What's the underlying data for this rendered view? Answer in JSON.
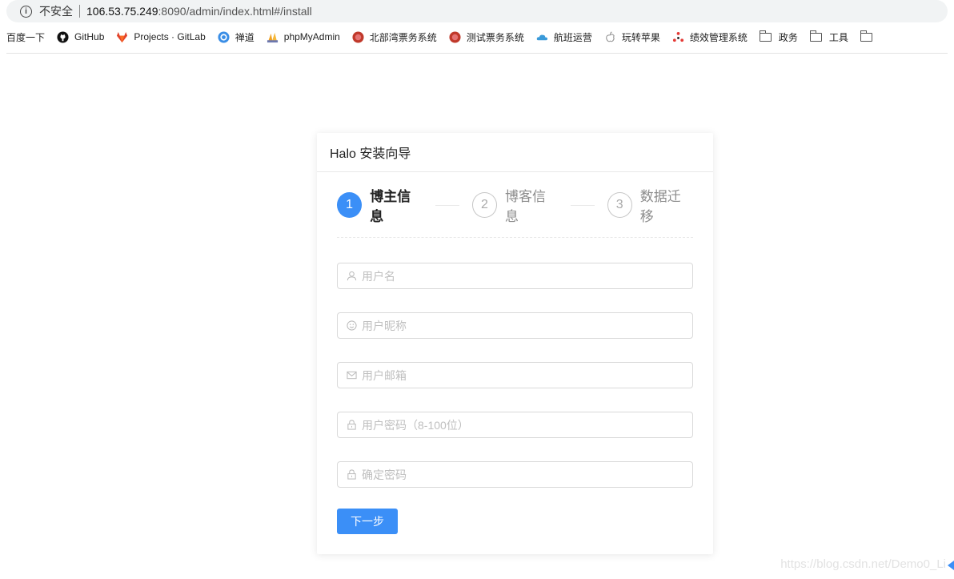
{
  "address_bar": {
    "security_text": "不安全",
    "host": "106.53.75.249",
    "path": ":8090/admin/index.html#/install"
  },
  "bookmarks": [
    {
      "label": "百度一下",
      "icon": "",
      "color": ""
    },
    {
      "label": "GitHub",
      "icon": "github-icon",
      "color": "#111111"
    },
    {
      "label": "Projects · GitLab",
      "icon": "gitlab-icon",
      "color": "#e2432a"
    },
    {
      "label": "禅道",
      "icon": "zentao-icon",
      "color": "#3a8ee6"
    },
    {
      "label": "phpMyAdmin",
      "icon": "phpmyadmin-icon",
      "color": "#f0a020"
    },
    {
      "label": "北部湾票务系统",
      "icon": "ticket-icon",
      "color": "#c0392b"
    },
    {
      "label": "测试票务系统",
      "icon": "ticket-icon",
      "color": "#c0392b"
    },
    {
      "label": "航班运营",
      "icon": "cloud-icon",
      "color": "#3a9ad9"
    },
    {
      "label": "玩转苹果",
      "icon": "apple-icon",
      "color": "#999999"
    },
    {
      "label": "绩效管理系统",
      "icon": "dots-icon",
      "color": "#e53935"
    },
    {
      "label": "政务",
      "icon": "folder-icon",
      "color": ""
    },
    {
      "label": "工具",
      "icon": "folder-icon",
      "color": ""
    },
    {
      "label": "",
      "icon": "folder-icon",
      "color": ""
    }
  ],
  "card": {
    "title": "Halo 安装向导",
    "steps": [
      {
        "number": "1",
        "label": "博主信息",
        "active": true
      },
      {
        "number": "2",
        "label": "博客信息",
        "active": false
      },
      {
        "number": "3",
        "label": "数据迁移",
        "active": false
      }
    ],
    "fields": [
      {
        "placeholder": "用户名",
        "value": "",
        "icon": "user-icon"
      },
      {
        "placeholder": "用户昵称",
        "value": "",
        "icon": "smile-icon"
      },
      {
        "placeholder": "用户邮箱",
        "value": "",
        "icon": "mail-icon"
      },
      {
        "placeholder": "用户密码（8-100位）",
        "value": "",
        "icon": "lock-icon"
      },
      {
        "placeholder": "确定密码",
        "value": "",
        "icon": "lock-icon"
      }
    ],
    "next_button": "下一步"
  },
  "watermark": "https://blog.csdn.net/Demo0_Li",
  "colors": {
    "primary": "#3b8ff7",
    "border": "#d9d9d9",
    "placeholder": "#bfbfbf"
  }
}
